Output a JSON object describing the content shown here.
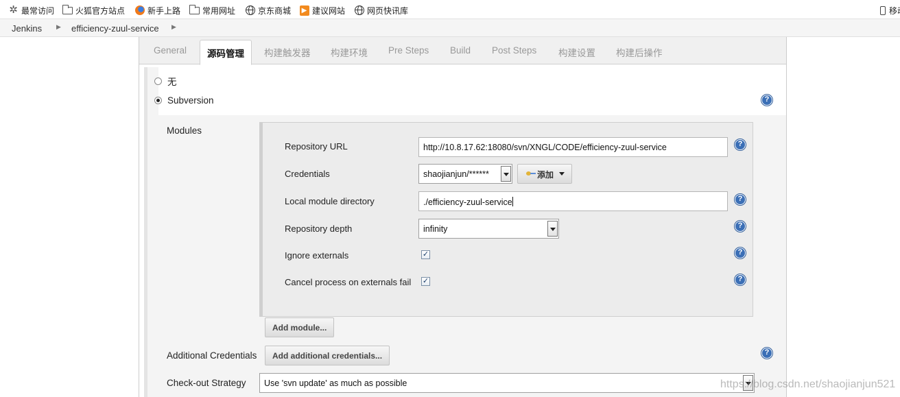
{
  "bookmarks": {
    "most_visited": "最常访问",
    "firefox_site": "火狐官方站点",
    "getting_started": "新手上路",
    "common_sites": "常用网址",
    "jd": "京东商城",
    "suggested_sites": "建议网站",
    "web_slices": "网页快讯库",
    "mobile": "移动"
  },
  "breadcrumb": {
    "root": "Jenkins",
    "job": "efficiency-zuul-service"
  },
  "tabs": {
    "general": "General",
    "scm": "源码管理",
    "triggers": "构建触发器",
    "env": "构建环境",
    "pre_steps": "Pre Steps",
    "build": "Build",
    "post_steps": "Post Steps",
    "settings": "构建设置",
    "post_build": "构建后操作"
  },
  "scm": {
    "option_none": "无",
    "option_svn": "Subversion",
    "selected": "Subversion",
    "modules_label": "Modules",
    "repo_url_label": "Repository URL",
    "repo_url_value": "http://10.8.17.62:18080/svn/XNGL/CODE/efficiency-zuul-service",
    "credentials_label": "Credentials",
    "credentials_value": "shaojianjun/******",
    "add_label": "添加",
    "local_dir_label": "Local module directory",
    "local_dir_value": "./efficiency-zuul-service",
    "depth_label": "Repository depth",
    "depth_value": "infinity",
    "ignore_externals_label": "Ignore externals",
    "ignore_externals": true,
    "cancel_externals_label": "Cancel process on externals fail",
    "cancel_externals": true,
    "add_module_label": "Add module...",
    "additional_credentials_label": "Additional Credentials",
    "add_additional_credentials_label": "Add additional credentials...",
    "checkout_strategy_label": "Check-out Strategy",
    "checkout_strategy_value": "Use 'svn update' as much as possible"
  },
  "watermark": "https://blog.csdn.net/shaojianjun521"
}
